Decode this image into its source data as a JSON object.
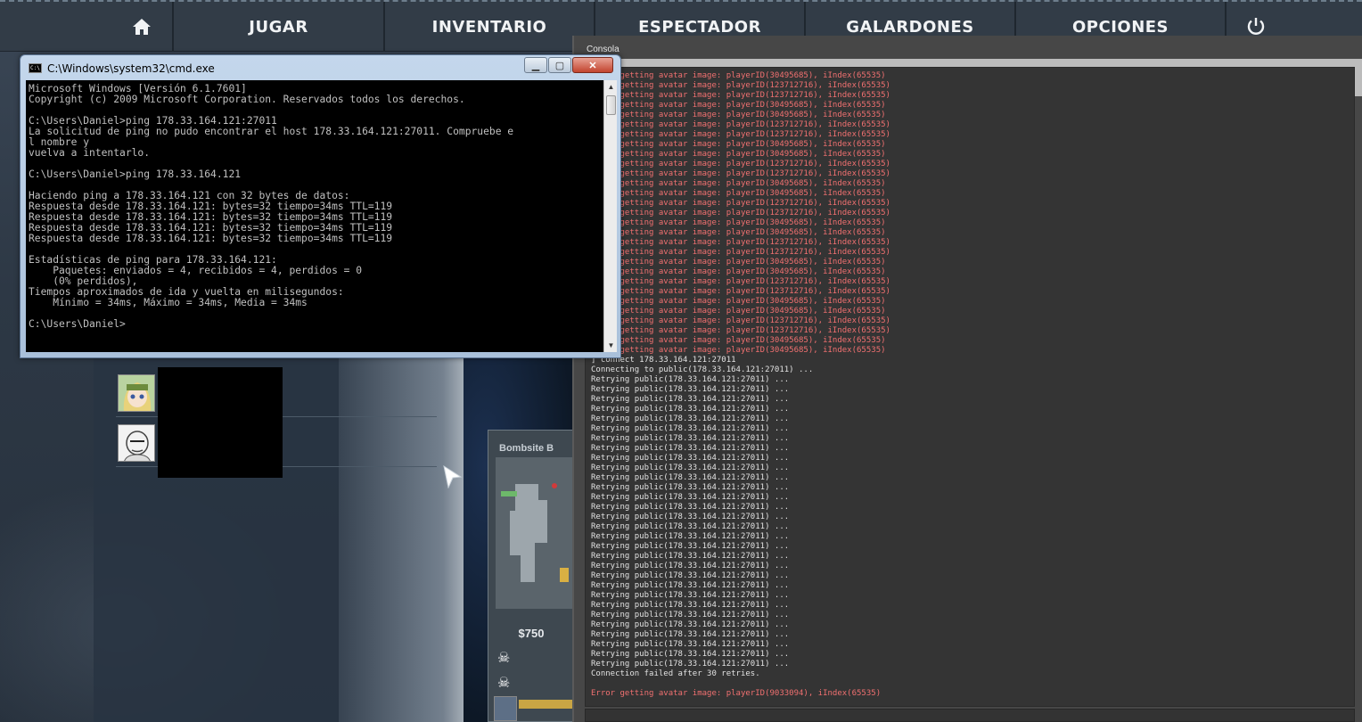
{
  "nav": {
    "items": [
      "JUGAR",
      "INVENTARIO",
      "ESPECTADOR",
      "GALARDONES",
      "OPCIONES"
    ]
  },
  "cmd": {
    "title": "C:\\Windows\\system32\\cmd.exe",
    "icon_text": "C:\\",
    "min_label": "▁",
    "max_label": "▢",
    "close_label": "✕",
    "lines": [
      "Microsoft Windows [Versión 6.1.7601]",
      "Copyright (c) 2009 Microsoft Corporation. Reservados todos los derechos.",
      "",
      "C:\\Users\\Daniel>ping 178.33.164.121:27011",
      "La solicitud de ping no pudo encontrar el host 178.33.164.121:27011. Compruebe e",
      "l nombre y",
      "vuelva a intentarlo.",
      "",
      "C:\\Users\\Daniel>ping 178.33.164.121",
      "",
      "Haciendo ping a 178.33.164.121 con 32 bytes de datos:",
      "Respuesta desde 178.33.164.121: bytes=32 tiempo=34ms TTL=119",
      "Respuesta desde 178.33.164.121: bytes=32 tiempo=34ms TTL=119",
      "Respuesta desde 178.33.164.121: bytes=32 tiempo=34ms TTL=119",
      "Respuesta desde 178.33.164.121: bytes=32 tiempo=34ms TTL=119",
      "",
      "Estadísticas de ping para 178.33.164.121:",
      "    Paquetes: enviados = 4, recibidos = 4, perdidos = 0",
      "    (0% perdidos),",
      "Tiempos aproximados de ida y vuelta en milisegundos:",
      "    Mínimo = 34ms, Máximo = 34ms, Media = 34ms",
      "",
      "C:\\Users\\Daniel>"
    ]
  },
  "console": {
    "title": "Consola",
    "lines": [
      {
        "t": "Error getting avatar image: playerID(30495685), iIndex(65535)",
        "c": "err"
      },
      {
        "t": "Error getting avatar image: playerID(123712716), iIndex(65535)",
        "c": "err"
      },
      {
        "t": "Error getting avatar image: playerID(123712716), iIndex(65535)",
        "c": "err"
      },
      {
        "t": "Error getting avatar image: playerID(30495685), iIndex(65535)",
        "c": "err"
      },
      {
        "t": "Error getting avatar image: playerID(30495685), iIndex(65535)",
        "c": "err"
      },
      {
        "t": "Error getting avatar image: playerID(123712716), iIndex(65535)",
        "c": "err"
      },
      {
        "t": "Error getting avatar image: playerID(123712716), iIndex(65535)",
        "c": "err"
      },
      {
        "t": "Error getting avatar image: playerID(30495685), iIndex(65535)",
        "c": "err"
      },
      {
        "t": "Error getting avatar image: playerID(30495685), iIndex(65535)",
        "c": "err"
      },
      {
        "t": "Error getting avatar image: playerID(123712716), iIndex(65535)",
        "c": "err"
      },
      {
        "t": "Error getting avatar image: playerID(123712716), iIndex(65535)",
        "c": "err"
      },
      {
        "t": "Error getting avatar image: playerID(30495685), iIndex(65535)",
        "c": "err"
      },
      {
        "t": "Error getting avatar image: playerID(30495685), iIndex(65535)",
        "c": "err"
      },
      {
        "t": "Error getting avatar image: playerID(123712716), iIndex(65535)",
        "c": "err"
      },
      {
        "t": "Error getting avatar image: playerID(123712716), iIndex(65535)",
        "c": "err"
      },
      {
        "t": "Error getting avatar image: playerID(30495685), iIndex(65535)",
        "c": "err"
      },
      {
        "t": "Error getting avatar image: playerID(30495685), iIndex(65535)",
        "c": "err"
      },
      {
        "t": "Error getting avatar image: playerID(123712716), iIndex(65535)",
        "c": "err"
      },
      {
        "t": "Error getting avatar image: playerID(123712716), iIndex(65535)",
        "c": "err"
      },
      {
        "t": "Error getting avatar image: playerID(30495685), iIndex(65535)",
        "c": "err"
      },
      {
        "t": "Error getting avatar image: playerID(30495685), iIndex(65535)",
        "c": "err"
      },
      {
        "t": "Error getting avatar image: playerID(123712716), iIndex(65535)",
        "c": "err"
      },
      {
        "t": "Error getting avatar image: playerID(123712716), iIndex(65535)",
        "c": "err"
      },
      {
        "t": "Error getting avatar image: playerID(30495685), iIndex(65535)",
        "c": "err"
      },
      {
        "t": "Error getting avatar image: playerID(30495685), iIndex(65535)",
        "c": "err"
      },
      {
        "t": "Error getting avatar image: playerID(123712716), iIndex(65535)",
        "c": "err"
      },
      {
        "t": "Error getting avatar image: playerID(123712716), iIndex(65535)",
        "c": "err"
      },
      {
        "t": "Error getting avatar image: playerID(30495685), iIndex(65535)",
        "c": "err"
      },
      {
        "t": "Error getting avatar image: playerID(30495685), iIndex(65535)",
        "c": "err"
      },
      {
        "t": "] connect 178.33.164.121:27011",
        "c": "norm"
      },
      {
        "t": "Connecting to public(178.33.164.121:27011) ...",
        "c": "norm"
      },
      {
        "t": "Retrying public(178.33.164.121:27011) ...",
        "c": "norm"
      },
      {
        "t": "Retrying public(178.33.164.121:27011) ...",
        "c": "norm"
      },
      {
        "t": "Retrying public(178.33.164.121:27011) ...",
        "c": "norm"
      },
      {
        "t": "Retrying public(178.33.164.121:27011) ...",
        "c": "norm"
      },
      {
        "t": "Retrying public(178.33.164.121:27011) ...",
        "c": "norm"
      },
      {
        "t": "Retrying public(178.33.164.121:27011) ...",
        "c": "norm"
      },
      {
        "t": "Retrying public(178.33.164.121:27011) ...",
        "c": "norm"
      },
      {
        "t": "Retrying public(178.33.164.121:27011) ...",
        "c": "norm"
      },
      {
        "t": "Retrying public(178.33.164.121:27011) ...",
        "c": "norm"
      },
      {
        "t": "Retrying public(178.33.164.121:27011) ...",
        "c": "norm"
      },
      {
        "t": "Retrying public(178.33.164.121:27011) ...",
        "c": "norm"
      },
      {
        "t": "Retrying public(178.33.164.121:27011) ...",
        "c": "norm"
      },
      {
        "t": "Retrying public(178.33.164.121:27011) ...",
        "c": "norm"
      },
      {
        "t": "Retrying public(178.33.164.121:27011) ...",
        "c": "norm"
      },
      {
        "t": "Retrying public(178.33.164.121:27011) ...",
        "c": "norm"
      },
      {
        "t": "Retrying public(178.33.164.121:27011) ...",
        "c": "norm"
      },
      {
        "t": "Retrying public(178.33.164.121:27011) ...",
        "c": "norm"
      },
      {
        "t": "Retrying public(178.33.164.121:27011) ...",
        "c": "norm"
      },
      {
        "t": "Retrying public(178.33.164.121:27011) ...",
        "c": "norm"
      },
      {
        "t": "Retrying public(178.33.164.121:27011) ...",
        "c": "norm"
      },
      {
        "t": "Retrying public(178.33.164.121:27011) ...",
        "c": "norm"
      },
      {
        "t": "Retrying public(178.33.164.121:27011) ...",
        "c": "norm"
      },
      {
        "t": "Retrying public(178.33.164.121:27011) ...",
        "c": "norm"
      },
      {
        "t": "Retrying public(178.33.164.121:27011) ...",
        "c": "norm"
      },
      {
        "t": "Retrying public(178.33.164.121:27011) ...",
        "c": "norm"
      },
      {
        "t": "Retrying public(178.33.164.121:27011) ...",
        "c": "norm"
      },
      {
        "t": "Retrying public(178.33.164.121:27011) ...",
        "c": "norm"
      },
      {
        "t": "Retrying public(178.33.164.121:27011) ...",
        "c": "norm"
      },
      {
        "t": "Retrying public(178.33.164.121:27011) ...",
        "c": "norm"
      },
      {
        "t": "Retrying public(178.33.164.121:27011) ...",
        "c": "norm"
      },
      {
        "t": "Connection failed after 30 retries.",
        "c": "norm"
      },
      {
        "t": "",
        "c": "norm"
      },
      {
        "t": "Error getting avatar image: playerID(9033094), iIndex(65535)",
        "c": "err"
      }
    ]
  },
  "map_card": {
    "title": "Bombsite B",
    "price": "$750"
  },
  "icons": {
    "home": "home-icon",
    "power": "power-icon",
    "skull": "skull-icon",
    "cursor": "mouse-cursor-icon"
  }
}
